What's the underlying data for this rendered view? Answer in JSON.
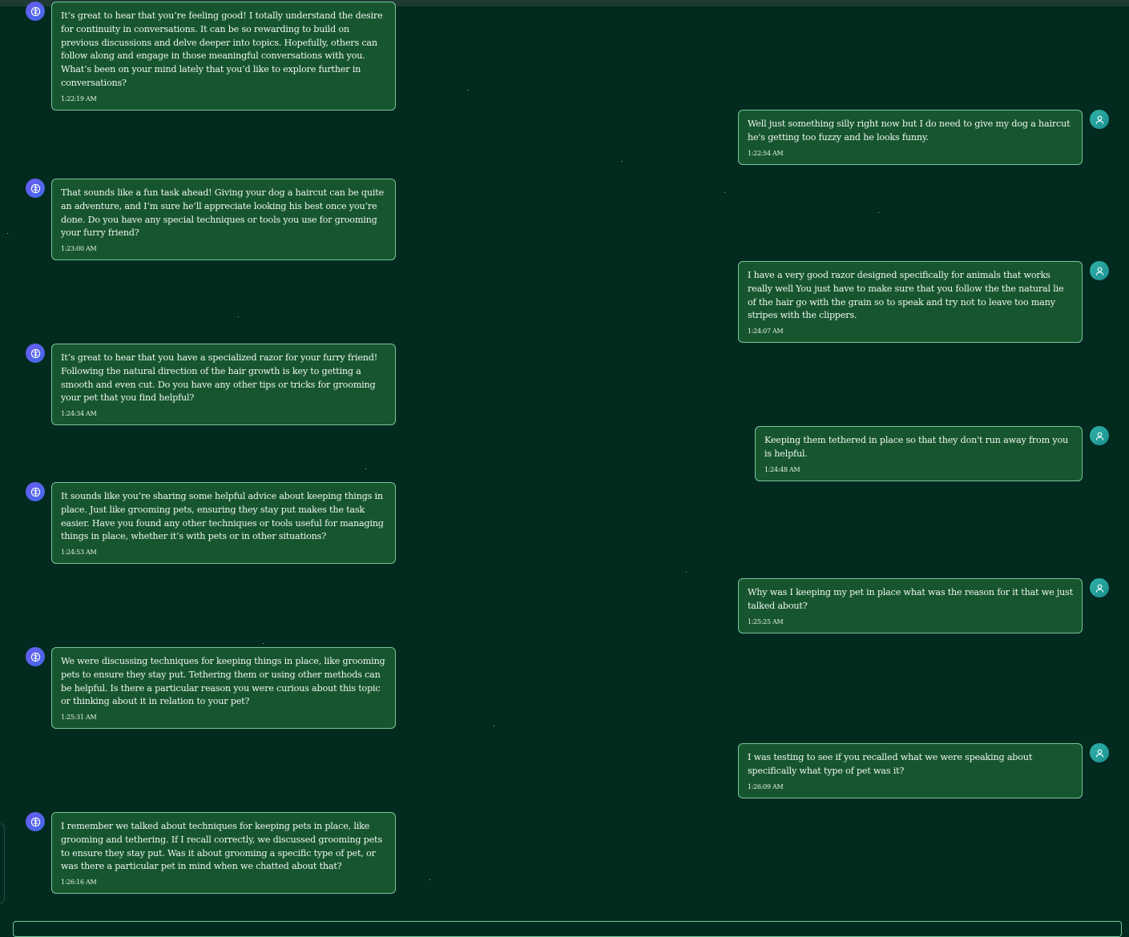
{
  "messages": [
    {
      "role": "assistant",
      "text": "It’s great to hear that you’re feeling good! I totally understand the desire for continuity in conversations. It can be so rewarding to build on previous discussions and delve deeper into topics. Hopefully, others can follow along and engage in those meaningful conversations with you. What’s been on your mind lately that you’d like to explore further in conversations?",
      "time": "1:22:19 AM"
    },
    {
      "role": "user",
      "text": "Well just something silly right now but I do need to give my dog a haircut he's getting too fuzzy and he looks funny.",
      "time": "1:22:54 AM"
    },
    {
      "role": "assistant",
      "text": "That sounds like a fun task ahead! Giving your dog a haircut can be quite an adventure, and I’m sure he’ll appreciate looking his best once you’re done. Do you have any special techniques or tools you use for grooming your furry friend?",
      "time": "1:23:00 AM"
    },
    {
      "role": "user",
      "text": "I have a very good razor designed specifically for animals that works really well You just have to make sure that you follow the the natural lie of the hair go with the grain so to speak and try not to leave too many stripes with the clippers.",
      "time": "1:24:07 AM"
    },
    {
      "role": "assistant",
      "text": "It’s great to hear that you have a specialized razor for your furry friend! Following the natural direction of the hair growth is key to getting a smooth and even cut. Do you have any other tips or tricks for grooming your pet that you find helpful?",
      "time": "1:24:34 AM"
    },
    {
      "role": "user",
      "text": "Keeping them tethered in place so that they don't run away from you is helpful.",
      "time": "1:24:48 AM"
    },
    {
      "role": "assistant",
      "text": "It sounds like you’re sharing some helpful advice about keeping things in place. Just like grooming pets, ensuring they stay put makes the task easier. Have you found any other techniques or tools useful for managing things in place, whether it’s with pets or in other situations?",
      "time": "1:24:53 AM"
    },
    {
      "role": "user",
      "text": "Why was I keeping my pet in place what was the reason for it that we just talked about?",
      "time": "1:25:25 AM"
    },
    {
      "role": "assistant",
      "text": "We were discussing techniques for keeping things in place, like grooming pets to ensure they stay put. Tethering them or using other methods can be helpful. Is there a particular reason you were curious about this topic or thinking about it in relation to your pet?",
      "time": "1:25:31 AM"
    },
    {
      "role": "user",
      "text": "I was testing to see if you recalled what we were speaking about specifically what type of pet was it?",
      "time": "1:26:09 AM"
    },
    {
      "role": "assistant",
      "text": "I remember we talked about techniques for keeping pets in place, like grooming and tethering. If I recall correctly, we discussed grooming pets to ensure they stay put. Was it about grooming a specific type of pet, or was there a particular pet in mind when we chatted about that?",
      "time": "1:26:16 AM"
    }
  ],
  "icons": {
    "assistant_avatar": "brain-icon",
    "user_avatar": "user-icon"
  },
  "colors": {
    "background": "#022a1f",
    "bubble": "#17552f",
    "bubble_border": "#74c79a",
    "assistant_avatar": "#5b63ee",
    "user_avatar": "#23a39c"
  }
}
